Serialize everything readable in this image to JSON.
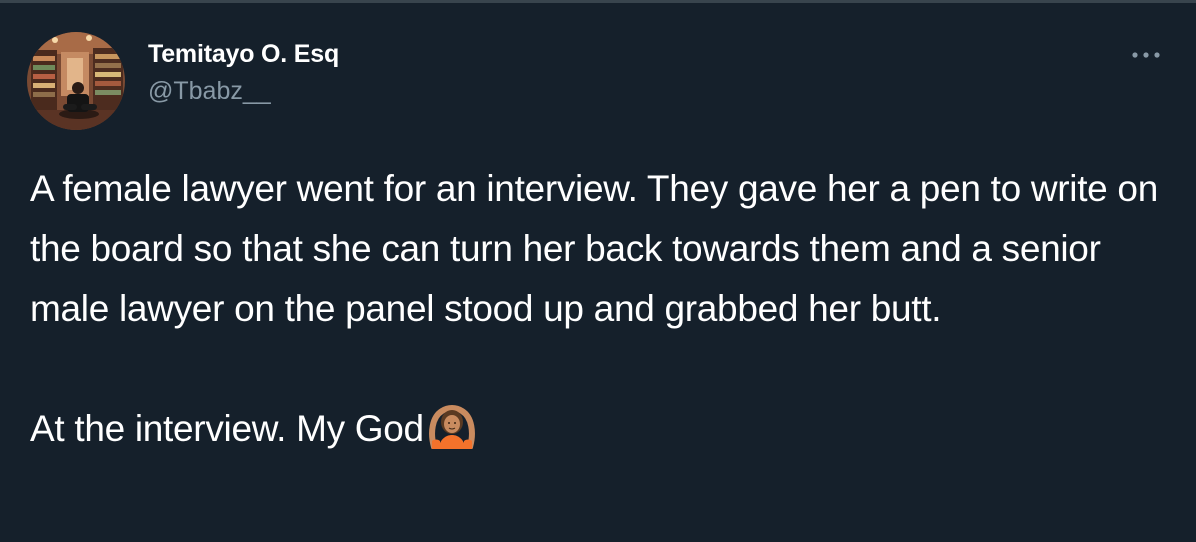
{
  "author": {
    "display_name": "Temitayo O. Esq",
    "handle": "@Tbabz__"
  },
  "tweet": {
    "paragraph_1": "A female lawyer went for an interview. They gave her a pen to write on the board so that she can turn her back towards them and a senior male lawyer on the panel stood up and grabbed her butt.",
    "paragraph_2": "At the interview. My God",
    "emoji": "woman-gesturing-ok-icon"
  },
  "icons": {
    "more": "more-options-icon",
    "avatar": "profile-photo"
  },
  "colors": {
    "background": "#15202b",
    "text_primary": "#ffffff",
    "text_secondary": "#8899a6",
    "divider": "#38444d"
  }
}
